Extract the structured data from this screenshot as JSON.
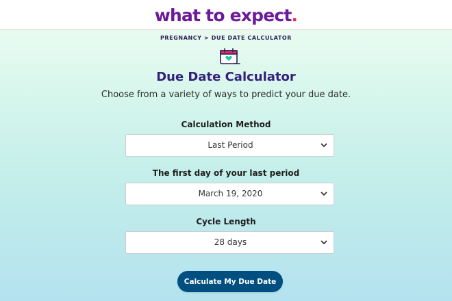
{
  "brand": {
    "logo_text": "what to expect",
    "logo_dot": ".",
    "primary_color": "#6a1a9a",
    "accent_color": "#e62a6e"
  },
  "breadcrumb": "PREGNANCY > DUE DATE CALCULATOR",
  "page": {
    "icon": "calendar-heart-icon",
    "title": "Due Date Calculator",
    "subtitle": "Choose from a variety of ways to predict your due date."
  },
  "form": {
    "method": {
      "label": "Calculation Method",
      "value": "Last Period"
    },
    "first_day": {
      "label": "The first day of your last period",
      "value": "March 19, 2020"
    },
    "cycle": {
      "label": "Cycle Length",
      "value": "28 days"
    },
    "submit_label": "Calculate My Due Date",
    "button_color": "#004f80"
  }
}
